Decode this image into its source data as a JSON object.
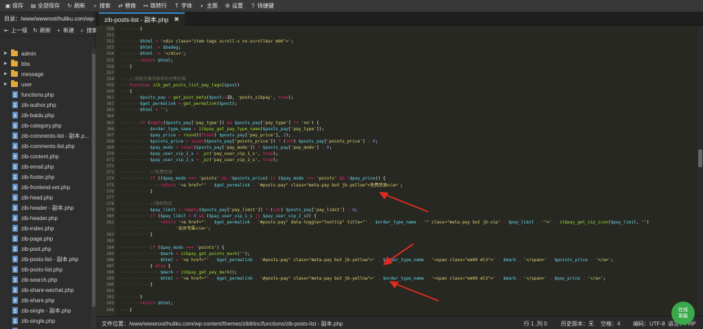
{
  "toolbar": {
    "items": [
      {
        "icon": "save-icon",
        "label": "保存"
      },
      {
        "icon": "save-all-icon",
        "label": "全部保存"
      },
      {
        "icon": "refresh-icon",
        "label": "刷新"
      },
      {
        "icon": "search-icon",
        "label": "搜索"
      },
      {
        "icon": "replace-icon",
        "label": "替换"
      },
      {
        "icon": "goto-line-icon",
        "label": "跳转行"
      },
      {
        "icon": "font-icon",
        "label": "字体"
      },
      {
        "icon": "theme-icon",
        "label": "主题"
      },
      {
        "icon": "gear-icon",
        "label": "设置"
      },
      {
        "icon": "help-icon",
        "label": "快捷键"
      }
    ]
  },
  "sidebar": {
    "path_label": "目录：/www/wwwroot/huliku.com/wp-...",
    "actions": [
      {
        "icon": "up-icon",
        "label": "上一级"
      },
      {
        "icon": "refresh-icon",
        "label": "刷新"
      },
      {
        "icon": "plus-icon",
        "label": "新建"
      },
      {
        "icon": "search-icon",
        "label": "搜索"
      }
    ],
    "tree": [
      {
        "type": "folder",
        "label": "admin"
      },
      {
        "type": "folder",
        "label": "bbs"
      },
      {
        "type": "folder",
        "label": "message"
      },
      {
        "type": "folder",
        "label": "user"
      },
      {
        "type": "file",
        "label": "functions.php"
      },
      {
        "type": "file",
        "label": "zib-author.php"
      },
      {
        "type": "file",
        "label": "zib-baidu.php"
      },
      {
        "type": "file",
        "label": "zib-category.php"
      },
      {
        "type": "file",
        "label": "zib-comments-list - 副本.p..."
      },
      {
        "type": "file",
        "label": "zib-comments-list.php"
      },
      {
        "type": "file",
        "label": "zib-content.php"
      },
      {
        "type": "file",
        "label": "zib-email.php"
      },
      {
        "type": "file",
        "label": "zib-footer.php"
      },
      {
        "type": "file",
        "label": "zib-frontend-set.php"
      },
      {
        "type": "file",
        "label": "zib-head.php"
      },
      {
        "type": "file",
        "label": "zib-header - 副本.php"
      },
      {
        "type": "file",
        "label": "zib-header.php"
      },
      {
        "type": "file",
        "label": "zib-index.php"
      },
      {
        "type": "file",
        "label": "zib-page.php"
      },
      {
        "type": "file",
        "label": "zib-post.php"
      },
      {
        "type": "file",
        "label": "zib-posts-list - 副本.php"
      },
      {
        "type": "file",
        "label": "zib-posts-list.php"
      },
      {
        "type": "file",
        "label": "zib-search.php"
      },
      {
        "type": "file",
        "label": "zib-share-wechat.php"
      },
      {
        "type": "file",
        "label": "zib-share.php"
      },
      {
        "type": "file",
        "label": "zib-single - 副本.php"
      },
      {
        "type": "file",
        "label": "zib-single.php"
      },
      {
        "type": "file",
        "label": "zib-svg-icon.php"
      }
    ]
  },
  "tab": {
    "title": "zib-posts-list - 副本.php",
    "close_icon": "close-icon"
  },
  "editor": {
    "lines": [
      {
        "n": "350",
        "t": "}"
      },
      {
        "n": "351",
        "t": ""
      },
      {
        "n": "352",
        "t": "$html = '<div class=\"item-tags scroll-x no-scrollbar mb6\">';"
      },
      {
        "n": "353",
        "t": "$html .= $badeg;"
      },
      {
        "n": "354",
        "t": "$html .= '</div>';"
      },
      {
        "n": "355",
        "t": "return $html;"
      },
      {
        "n": "356",
        "t": "}"
      },
      {
        "n": "357",
        "t": ""
      },
      {
        "n": "358",
        "t": "//获取文章列表中的付费价格"
      },
      {
        "n": "359",
        "t": "function zib_get_posts_list_pay_tags($post)"
      },
      {
        "n": "360",
        "t": "{"
      },
      {
        "n": "361",
        "t": "$posts_pay = get_post_meta($post->ID, 'posts_zibpay', true);"
      },
      {
        "n": "362",
        "t": "$get_permalink = get_permalink($post);"
      },
      {
        "n": "363",
        "t": "$html = '';"
      },
      {
        "n": "364",
        "t": ""
      },
      {
        "n": "365",
        "t": "if (empty($posts_pay['pay_type']) && $posts_pay['pay_type'] != 'no') {"
      },
      {
        "n": "366",
        "t": "$order_type_name = zibpay_get_pay_type_name($posts_pay['pay_type']);"
      },
      {
        "n": "367",
        "t": "$pay_price = round((float) $posts_pay['pay_price'], 2);"
      },
      {
        "n": "368",
        "t": "$points_price = isset($posts_pay['points_price']) ? (int) $posts_pay['points_price'] : 0;"
      },
      {
        "n": "369",
        "t": "$pay_modo = isset($posts_pay['pay_modo']) ? $posts_pay['pay_modo'] : 0;"
      },
      {
        "n": "370",
        "t": "$pay_user_vip_1_s = _pz('pay_user_vip_1_s', true);"
      },
      {
        "n": "371",
        "t": "$pay_user_vip_2_s = _pz('pay_user_vip_2_s', true);"
      },
      {
        "n": "372",
        "t": ""
      },
      {
        "n": "373",
        "t": "//免费资源"
      },
      {
        "n": "374",
        "t": "if (($pay_modo === 'points' && !$points_price) || ($pay_modo !== 'points' && !$pay_price)) {"
      },
      {
        "n": "375",
        "t": "return '<a href=\"' . $get_permalink . '#posts-pay\" class=\"meta-pay but jb-yellow\">免费资源</a>';"
      },
      {
        "n": "376",
        "t": "}"
      },
      {
        "n": "377",
        "t": ""
      },
      {
        "n": "378",
        "t": "//限制购买"
      },
      {
        "n": "379",
        "t": "$pay_limit = !empty($posts_pay['pay_limit']) ? (int) $posts_pay['pay_limit'] : 0;"
      },
      {
        "n": "380",
        "t": "if ($pay_limit > 0 && ($pay_user_vip_1_s || $pay_user_vip_2_s)) {"
      },
      {
        "n": "381",
        "t": "return '<a href=\"' . $get_permalink . '#posts-pay\" data-toggle=\"tooltip\" title=\"' . $order_type_name . '\" class=\"meta-pay but jb-vip' . $pay_limit . '\">' . zibpay_get_vip_icon($pay_limit, '')"
      },
      {
        "n": "",
        "t": ". '会员专属</a>';"
      },
      {
        "n": "382",
        "t": "}"
      },
      {
        "n": "383",
        "t": ""
      },
      {
        "n": "384",
        "t": "if ($pay_modo === 'points') {"
      },
      {
        "n": "385",
        "t": "$mark = zibpay_get_points_mark('');"
      },
      {
        "n": "386",
        "t": "$html = '<a href=\"' . $get_permalink . '#posts-pay\" class=\"meta-pay but jb-yellow\">' . $order_type_name . '<span class=\"em09 ml3\">' . $mark . '</span>' . $points_price . '</a>';"
      },
      {
        "n": "387",
        "t": "} else {"
      },
      {
        "n": "388",
        "t": "$mark = zibpay_get_pay_mark();"
      },
      {
        "n": "389",
        "t": "$html = '<a href=\"' . $get_permalink . '#posts-pay\" class=\"meta-pay but jb-yellow\">' . $order_type_name . '<span class=\"em09 ml3\">' . $mark . '</span>' . $pay_price . '</a>';"
      },
      {
        "n": "390",
        "t": "}"
      },
      {
        "n": "391",
        "t": ""
      },
      {
        "n": "392",
        "t": "}"
      },
      {
        "n": "393",
        "t": "return $html;"
      },
      {
        "n": "394",
        "t": "}"
      }
    ],
    "indents": [
      2,
      0,
      2,
      2,
      2,
      2,
      1,
      0,
      1,
      1,
      1,
      2,
      2,
      2,
      0,
      2,
      3,
      3,
      3,
      3,
      3,
      3,
      0,
      3,
      3,
      4,
      3,
      0,
      3,
      3,
      3,
      4,
      5,
      3,
      0,
      3,
      4,
      4,
      3,
      4,
      4,
      3,
      0,
      2,
      2,
      1
    ]
  },
  "statusbar": {
    "path": "文件位置：/www/wwwroot/huliku.com/wp-content/themes/zibll/inc/functions/zib-posts-list - 副本.php",
    "cursor": "行 1 ,列 0",
    "history": "历史版本：无",
    "spaces": "空格：4",
    "encoding": "编码：UTF-8",
    "language": "语言：PHP"
  },
  "online_badge": {
    "line1": "在线",
    "line2": "客服"
  },
  "colors": {
    "arrow": "#e02b20",
    "tab_accent": "#3b8fd2",
    "online": "#3aa94b"
  }
}
